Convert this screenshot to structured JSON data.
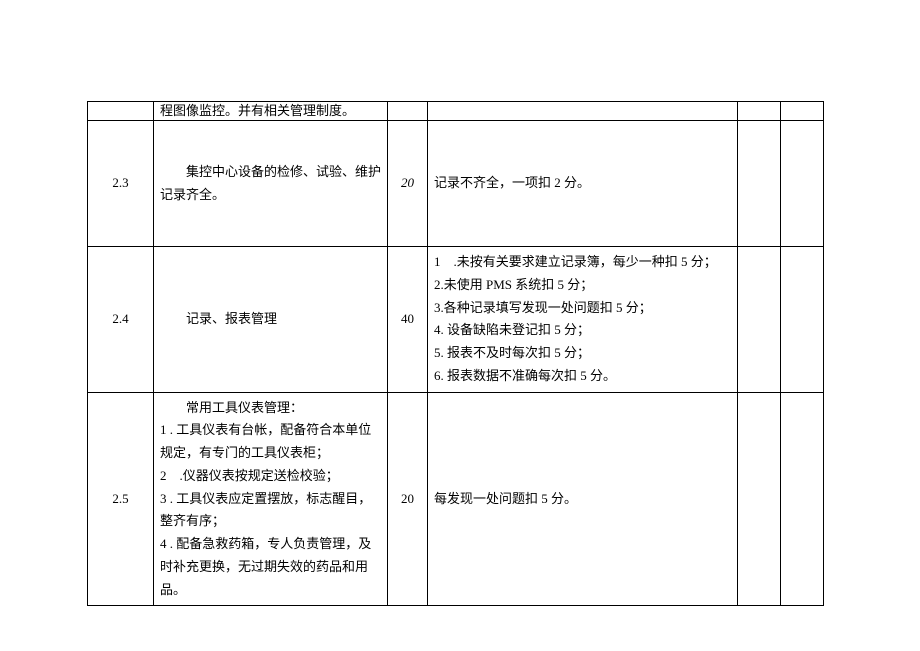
{
  "rows": [
    {
      "index": "",
      "desc": "程图像监控。并有相关管理制度。",
      "score": "",
      "score_italic": false,
      "criteria": [
        ""
      ],
      "a": "",
      "b": ""
    },
    {
      "index": "2.3",
      "desc": "集控中心设备的检修、试验、维护记录齐全。",
      "score": "20",
      "score_italic": true,
      "criteria": [
        "记录不齐全，一项扣 2 分。"
      ],
      "a": "",
      "b": ""
    },
    {
      "index": "2.4",
      "desc": "记录、报表管理",
      "score": "40",
      "score_italic": false,
      "criteria": [
        "1　.未按有关要求建立记录簿，每少一种扣 5 分；",
        "2.未使用 PMS 系统扣 5 分；",
        "3.各种记录填写发现一处问题扣 5 分；",
        "4. 设备缺陷未登记扣 5 分；",
        "5. 报表不及时每次扣 5 分；",
        "6. 报表数据不准确每次扣 5 分。"
      ],
      "a": "",
      "b": ""
    },
    {
      "index": "2.5",
      "desc_lines": [
        "常用工具仪表管理：",
        "1 . 工具仪表有台帐，配备符合本单位规定，有专门的工具仪表柜；",
        "2　.仪器仪表按规定送检校验；",
        "3 . 工具仪表应定置摆放，标志醒目，整齐有序；",
        "4 . 配备急救药箱，专人负责管理，及时补充更换，无过期失效的药品和用品。"
      ],
      "score": "20",
      "score_italic": false,
      "criteria": [
        "每发现一处问题扣 5 分。"
      ],
      "a": "",
      "b": ""
    }
  ]
}
